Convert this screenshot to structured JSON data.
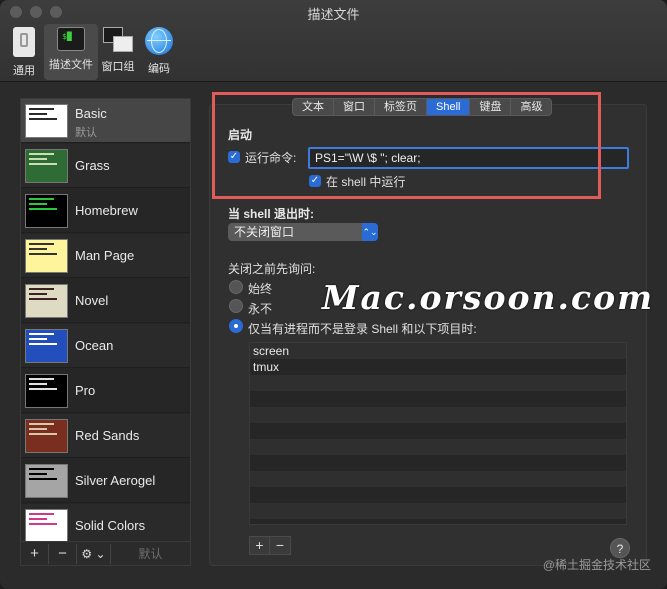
{
  "window": {
    "title": "描述文件"
  },
  "toolbar": [
    {
      "label": "通用",
      "icon": "switch-icon"
    },
    {
      "label": "描述文件",
      "icon": "terminal-icon"
    },
    {
      "label": "窗口组",
      "icon": "window-group-icon"
    },
    {
      "label": "编码",
      "icon": "globe-icon"
    }
  ],
  "sidebar": {
    "profiles": [
      {
        "name": "Basic",
        "subtitle": "默认",
        "colors": [
          "#ffffff",
          "#2a2a2a"
        ]
      },
      {
        "name": "Grass",
        "colors": [
          "#2e6b35",
          "#c8e0b0"
        ]
      },
      {
        "name": "Homebrew",
        "colors": [
          "#000000",
          "#27c93f"
        ]
      },
      {
        "name": "Man Page",
        "colors": [
          "#fef49c",
          "#333333"
        ]
      },
      {
        "name": "Novel",
        "colors": [
          "#dfdbc3",
          "#3b2322"
        ]
      },
      {
        "name": "Ocean",
        "colors": [
          "#224fbc",
          "#ffffff"
        ]
      },
      {
        "name": "Pro",
        "colors": [
          "#000000",
          "#e0e0e0"
        ]
      },
      {
        "name": "Red Sands",
        "colors": [
          "#7a2e20",
          "#d7c9a7"
        ]
      },
      {
        "name": "Silver Aerogel",
        "colors": [
          "#a5a5a5",
          "#000000"
        ]
      },
      {
        "name": "Solid Colors",
        "colors": [
          "#ffffff",
          "#d0398a"
        ]
      }
    ],
    "bottom": {
      "add": "+",
      "remove": "−",
      "gear": "⚙︎ ⌄",
      "default_label": "默认"
    }
  },
  "tabs": [
    "文本",
    "窗口",
    "标签页",
    "Shell",
    "键盘",
    "高级"
  ],
  "active_tab": "Shell",
  "shell": {
    "startup_label": "启动",
    "run_command_label": "运行命令:",
    "run_command_value": "PS1=\"\\W \\$ \"; clear;",
    "run_in_shell_label": "在 shell 中运行",
    "on_exit_label": "当 shell 退出时:",
    "on_exit_value": "不关闭窗口",
    "ask_before_close_label": "关闭之前先询问:",
    "options": [
      {
        "label": "始终",
        "selected": false
      },
      {
        "label": "永不",
        "selected": false
      },
      {
        "label": "仅当有进程而不是登录 Shell 和以下项目时:",
        "selected": true
      }
    ],
    "processes": [
      "screen",
      "tmux"
    ],
    "list_add": "+",
    "list_remove": "−",
    "help": "?"
  },
  "watermark": "Mac.orsoon.com",
  "credit": "@稀土掘金技术社区",
  "accent_color": "#2a6bd6",
  "highlight_box_color": "#e25b5b"
}
